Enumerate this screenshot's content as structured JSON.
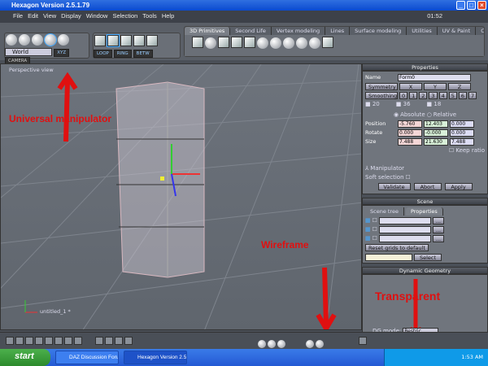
{
  "window": {
    "title": "Hexagon Version 2.5.1.79",
    "clock": "01:52"
  },
  "menu": [
    "File",
    "Edit",
    "View",
    "Display",
    "Window",
    "Selection",
    "Tools",
    "Help"
  ],
  "toolbar": {
    "coord_select": "World",
    "xyz": "XYZ",
    "camera": "CAMERA",
    "select_modes": [
      "LOOP",
      "RING",
      "BETW"
    ],
    "tabs": [
      "3D Primitives",
      "Second Life",
      "Vertex modeling",
      "Lines",
      "Surface modeling",
      "Utilities",
      "UV & Paint",
      "Cust"
    ]
  },
  "viewport": {
    "label": "Perspective view",
    "object_name": "untitled_1 *"
  },
  "properties": {
    "title": "Properties",
    "name_label": "Name",
    "name_value": "Form0",
    "symmetry": "Symmetry",
    "axes": [
      "X",
      "Y",
      "Z"
    ],
    "smoothing": "Smoothing",
    "smooth_levels": [
      "0",
      "1",
      "2",
      "3",
      "4",
      "5",
      "6",
      "7"
    ],
    "counts": [
      "20",
      "36",
      "18"
    ],
    "absolute": "Absolute",
    "relative": "Relative",
    "rows": [
      {
        "label": "Position",
        "values": [
          "-5.760",
          "12.403",
          "0.000"
        ]
      },
      {
        "label": "Rotate",
        "values": [
          "0.000",
          "-0.000",
          "0.000"
        ]
      },
      {
        "label": "Size",
        "values": [
          "7.488",
          "21.630",
          "7.488"
        ]
      }
    ],
    "keep_ratio": "Keep ratio",
    "manipulator": "Manipulator",
    "soft_selection": "Soft selection",
    "validate": "Validate",
    "abort": "Abort",
    "apply": "Apply"
  },
  "scene": {
    "title": "Scene",
    "tabs": [
      "Scene tree",
      "Properties"
    ],
    "reset": "Reset grids to default",
    "select": "Select"
  },
  "dynamic_geometry": {
    "title": "Dynamic Geometry",
    "dg_mode_label": "DG mode:",
    "dg_mode_value": "Restric..."
  },
  "annotations": {
    "manipulator": "Universal manipulator",
    "wireframe": "Wireframe",
    "transparent": "Transparent",
    "color": "#e01010"
  },
  "taskbar": {
    "start": "start",
    "tasks": [
      "DAZ Discussion Foru...",
      "Hexagon Version 2.5...."
    ],
    "time": "1:53 AM"
  }
}
